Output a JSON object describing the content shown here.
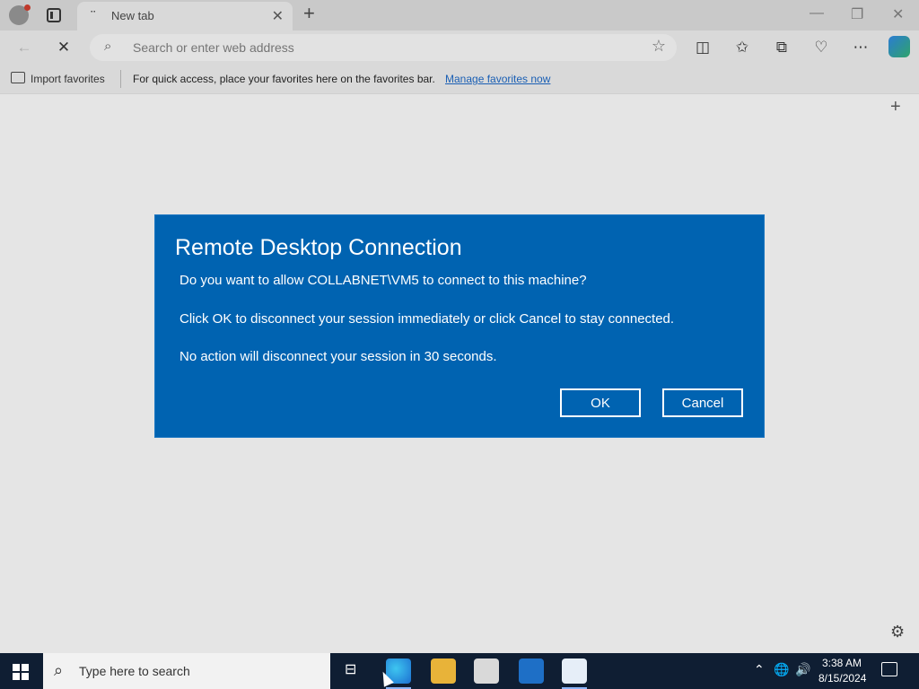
{
  "browser": {
    "tab": {
      "title": "New tab"
    },
    "address": {
      "placeholder": "Search or enter web address"
    },
    "favorites_bar": {
      "import_label": "Import favorites",
      "message": "For quick access, place your favorites here on the favorites bar.",
      "manage_link": "Manage favorites now"
    }
  },
  "dialog": {
    "title": "Remote Desktop Connection",
    "line1": "Do you want to allow COLLABNET\\VM5 to connect to this machine?",
    "line2": "Click OK to disconnect your session immediately or click Cancel to stay connected.",
    "line3": "No action will disconnect your session in 30 seconds.",
    "ok_label": "OK",
    "cancel_label": "Cancel"
  },
  "taskbar": {
    "search_placeholder": "Type here to search",
    "time": "3:38 AM",
    "date": "8/15/2024"
  },
  "colors": {
    "dialog_bg": "#0063b1",
    "taskbar_bg": "#0f1e33"
  }
}
